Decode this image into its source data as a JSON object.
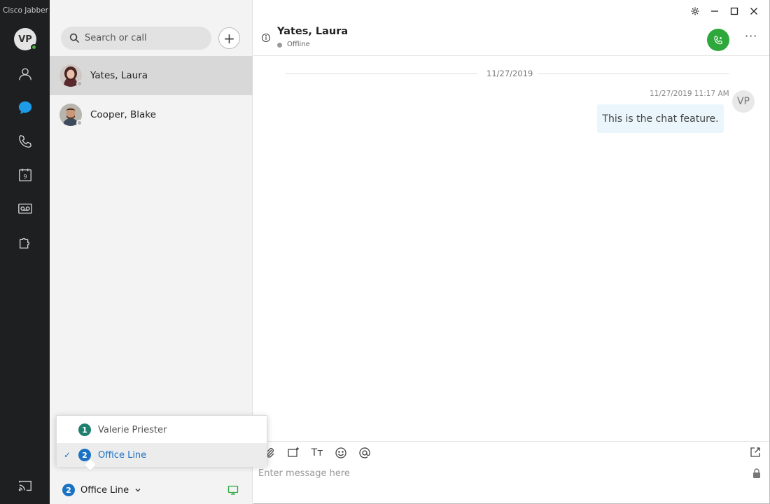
{
  "app": {
    "title": "Cisco Jabber"
  },
  "user": {
    "initials": "VP"
  },
  "search": {
    "placeholder": "Search or call"
  },
  "add_button": {
    "label": "+"
  },
  "contacts": [
    {
      "name": "Yates, Laura",
      "selected": true
    },
    {
      "name": "Cooper, Blake",
      "selected": false
    }
  ],
  "line_selector": {
    "current_number": "2",
    "current_label": "Office Line",
    "options": [
      {
        "number": "1",
        "label": "Valerie Priester",
        "badge_color": "#1f7f6e",
        "selected": false
      },
      {
        "number": "2",
        "label": "Office Line",
        "badge_color": "#1b72c4",
        "selected": true
      }
    ],
    "check_mark": "✓"
  },
  "chat": {
    "contact_name": "Yates, Laura",
    "status": "Offline",
    "more_label": "···",
    "date_separator": "11/27/2019",
    "messages": [
      {
        "time": "11/27/2019 11:17 AM",
        "sender_initials": "VP",
        "text": "This is the chat feature."
      }
    ],
    "composer_placeholder": "Enter message here",
    "font_tool_label": "Tт"
  },
  "colors": {
    "rail_bg": "#1e1f21",
    "accent": "#1b72c4",
    "call_green": "#2ea83a",
    "online_green": "#4bb543",
    "bubble_bg": "#eaf6fb"
  }
}
